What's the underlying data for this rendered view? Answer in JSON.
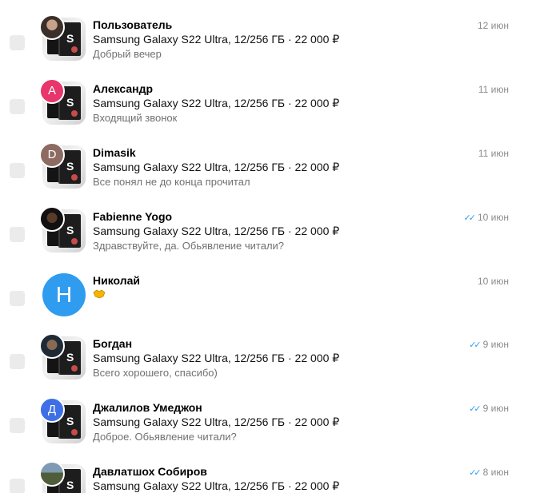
{
  "chats": [
    {
      "name": "Пользователь",
      "item": "Samsung Galaxy S22 Ultra, 12/256 ГБ · 22 000 ₽",
      "message": "Добрый вечер",
      "date": "12 июн",
      "read": false,
      "avatar_letter": "",
      "avatar_color": "",
      "avatar_icon": "user-photo-icon"
    },
    {
      "name": "Александр",
      "item": "Samsung Galaxy S22 Ultra, 12/256 ГБ · 22 000 ₽",
      "message": "Входящий звонок",
      "date": "11 июн",
      "read": false,
      "avatar_letter": "А",
      "avatar_color": "#e8356b",
      "avatar_icon": ""
    },
    {
      "name": "Dimasik",
      "item": "Samsung Galaxy S22 Ultra, 12/256 ГБ · 22 000 ₽",
      "message": "Все понял не до конца прочитал",
      "date": "11 июн",
      "read": false,
      "avatar_letter": "D",
      "avatar_color": "#8d6b63",
      "avatar_icon": ""
    },
    {
      "name": "Fabienne Yogo",
      "item": "Samsung Galaxy S22 Ultra, 12/256 ГБ · 22 000 ₽",
      "message": "Здравствуйте, да. Обьявление читали?",
      "date": "10 июн",
      "read": true,
      "avatar_letter": "",
      "avatar_color": "",
      "avatar_icon": "user-photo-icon"
    },
    {
      "name": "Николай",
      "item": "",
      "message": "",
      "date": "10 июн",
      "read": false,
      "avatar_letter": "Н",
      "avatar_color": "#2f9cf0",
      "avatar_icon": "",
      "emoji": "handshake-emoji"
    },
    {
      "name": "Богдан",
      "item": "Samsung Galaxy S22 Ultra, 12/256 ГБ · 22 000 ₽",
      "message": "Всего хорошего, спасибо)",
      "date": "9 июн",
      "read": true,
      "avatar_letter": "",
      "avatar_color": "",
      "avatar_icon": "user-photo-icon"
    },
    {
      "name": "Джалилов Умеджон",
      "item": "Samsung Galaxy S22 Ultra, 12/256 ГБ · 22 000 ₽",
      "message": "Доброе. Обьявление читали?",
      "date": "9 июн",
      "read": true,
      "avatar_letter": "Д",
      "avatar_color": "#3f6fe6",
      "avatar_icon": ""
    },
    {
      "name": "Давлатшох Собиров",
      "item": "Samsung Galaxy S22 Ultra, 12/256 ГБ · 22 000 ₽",
      "message": "",
      "date": "8 июн",
      "read": true,
      "avatar_letter": "",
      "avatar_color": "",
      "avatar_icon": "user-photo-icon"
    }
  ],
  "thumbnail": {
    "letter": "S",
    "icon": "phone-box-thumbnail"
  },
  "read_ticks": "✓✓",
  "colors": {
    "accent": "#2f9cf0",
    "muted": "#8a8a8a",
    "checkbox": "#ebebeb"
  }
}
